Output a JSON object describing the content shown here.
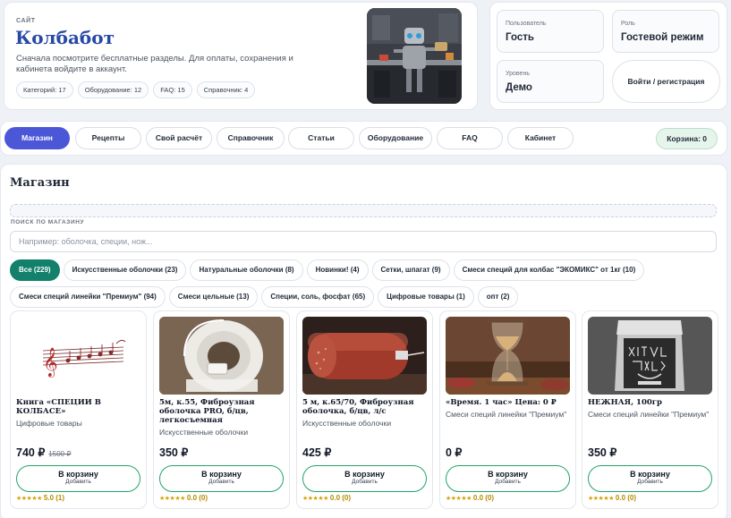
{
  "header": {
    "eyebrow": "САЙТ",
    "title": "Колбабот",
    "description": "Сначала посмотрите бесплатные разделы. Для оплаты, сохранения и кабинета войдите в аккаунт.",
    "chips": [
      "Категорий: 17",
      "Оборудование: 12",
      "FAQ: 15",
      "Справочник: 4"
    ]
  },
  "account": {
    "user_label": "Пользователь",
    "user_value": "Гость",
    "role_label": "Роль",
    "role_value": "Гостевой режим",
    "level_label": "Уровень",
    "level_value": "Демо",
    "login_button": "Войти / регистрация"
  },
  "nav": {
    "items": [
      "Магазин",
      "Рецепты",
      "Свой расчёт",
      "Справочник",
      "Статьи",
      "Оборудование",
      "FAQ",
      "Кабинет"
    ],
    "active": "Магазин",
    "cart": "Корзина: 0"
  },
  "shop": {
    "title": "Магазин",
    "search_label": "ПОИСК ПО МАГАЗИНУ",
    "search_placeholder": "Например: оболочка, специи, нож...",
    "search_value": "",
    "categories_row1": [
      "Все (229)",
      "Искусственные оболочки (23)",
      "Натуральные оболочки (8)",
      "Новинки! (4)",
      "Сетки, шпагат (9)",
      "Смеси специй для колбас \"ЭКОМИКС\" от 1кг (10)"
    ],
    "categories_row2": [
      "Смеси специй линейки \"Премиум\" (94)",
      "Смеси цельные (13)",
      "Специи, соль, фосфат (65)",
      "Цифровые товары (1)",
      "опт (2)"
    ],
    "active_category": "Все (229)",
    "products": [
      {
        "name": "Книга «СПЕЦИИ В КОЛБАСЕ»",
        "category": "Цифровые товары",
        "price": "740 ₽",
        "old_price": "1500 ₽",
        "buy": "В корзину",
        "buy_sub": "Добавить",
        "stars": "★★★★★",
        "rating": "5.0 (1)"
      },
      {
        "name": "5м, к.55, Фиброузная оболочка PRO, б/цв, легкосъемная",
        "category": "Искусственные оболочки",
        "price": "350 ₽",
        "old_price": "",
        "buy": "В корзину",
        "buy_sub": "Добавить",
        "stars": "★★★★★",
        "rating": "0.0 (0)"
      },
      {
        "name": "5 м, к.65/70, Фиброузная оболочка, б/цв, л/с",
        "category": "Искусственные оболочки",
        "price": "425 ₽",
        "old_price": "",
        "buy": "В корзину",
        "buy_sub": "Добавить",
        "stars": "★★★★★",
        "rating": "0.0 (0)"
      },
      {
        "name": "«Время. 1 час» Цена: 0 ₽",
        "category": "Смеси специй линейки \"Премиум\"",
        "price": "0 ₽",
        "old_price": "",
        "buy": "В корзину",
        "buy_sub": "Добавить",
        "stars": "★★★★★",
        "rating": "0.0 (0)"
      },
      {
        "name": "НЕЖНАЯ, 100гр",
        "category": "Смеси специй линейки \"Премиум\"",
        "price": "350 ₽",
        "old_price": "",
        "buy": "В корзину",
        "buy_sub": "Добавить",
        "stars": "★★★★★",
        "rating": "0.0 (0)"
      }
    ]
  },
  "colors": {
    "accent": "#4c57d8",
    "category_active": "#12806a",
    "buy_border": "#22a36b",
    "title": "#2749a6"
  }
}
